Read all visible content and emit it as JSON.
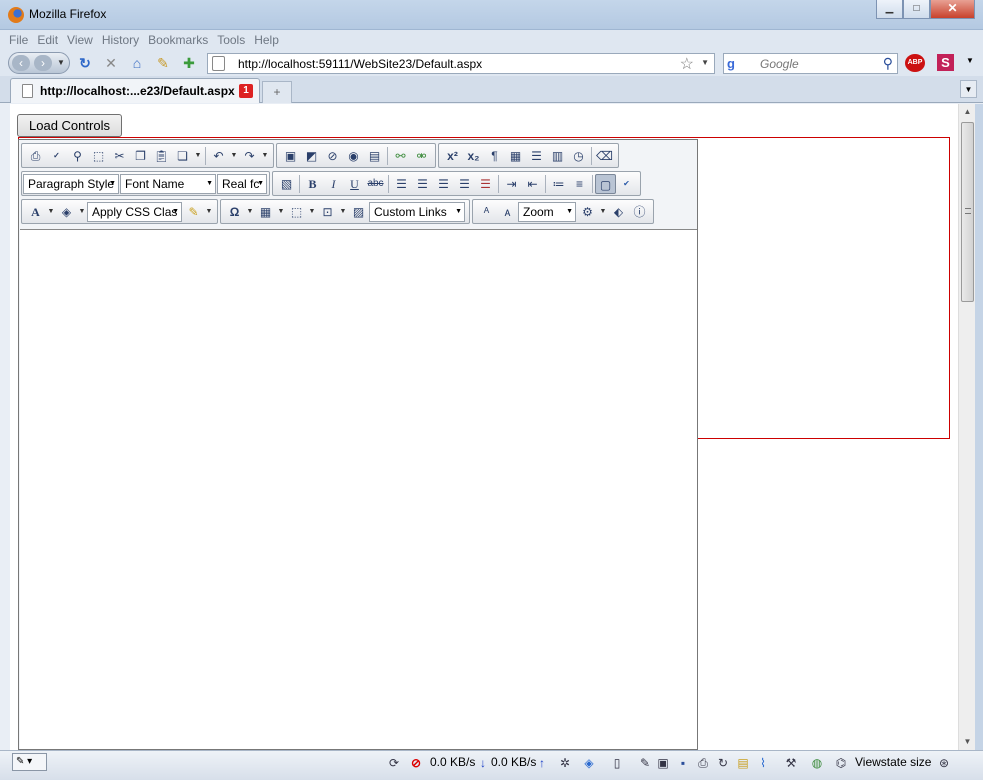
{
  "window": {
    "title": "Mozilla Firefox",
    "controls": {
      "minimize": "▁",
      "maximize": "□",
      "close": "✕"
    }
  },
  "menu": [
    "File",
    "Edit",
    "View",
    "History",
    "Bookmarks",
    "Tools",
    "Help"
  ],
  "navbar": {
    "back": "‹",
    "forward": "›",
    "url": "http://localhost:59111/WebSite23/Default.aspx",
    "search_placeholder": "Google",
    "search_engine_glyph": "g",
    "abp_label": "ABP",
    "s_label": "S"
  },
  "tabs": [
    {
      "label": "http://localhost:...e23/Default.aspx",
      "badge": "1"
    }
  ],
  "newtab_label": "+",
  "page": {
    "load_button": "Load Controls",
    "editor": {
      "combos": {
        "paragraph_style": "Paragraph Style",
        "font_name": "Font Name",
        "font_size": "Real fc",
        "apply_css": "Apply CSS Clas",
        "custom_links": "Custom Links",
        "zoom": "Zoom"
      },
      "row2_glyphs": {
        "bold": "B",
        "italic": "I",
        "underline": "U",
        "strike": "abc"
      },
      "row3_glyphs": {
        "forecolor": "A",
        "symbols": "Ω"
      },
      "row1_glyphs": {
        "superscript": "x²",
        "subscript": "x₂",
        "paragraph": "¶"
      }
    }
  },
  "statusbar": {
    "download_speed": "0.0 KB/s",
    "upload_speed": "0.0 KB/s",
    "viewstate": "Viewstate size"
  },
  "colors": {
    "accent_red": "#cc0000",
    "chrome_blue": "#dfe7f1"
  }
}
